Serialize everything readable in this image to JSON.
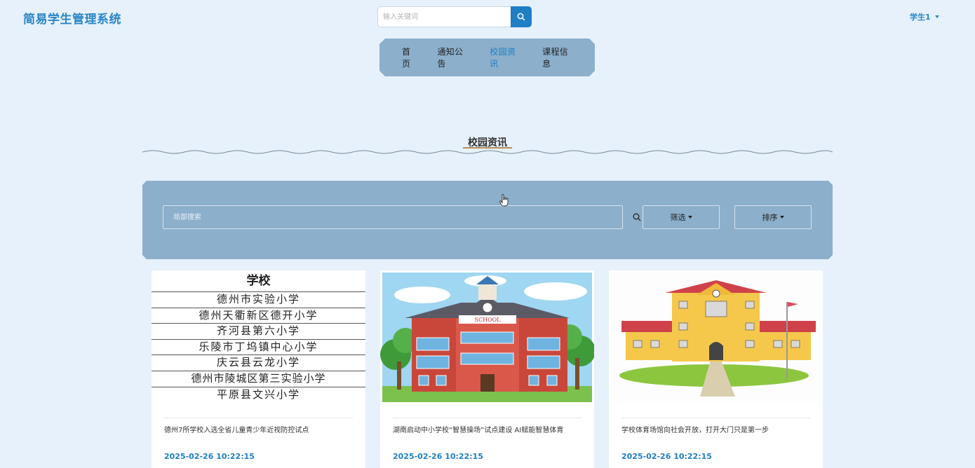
{
  "header": {
    "brand": "简易学生管理系统",
    "search_placeholder": "输入关键词",
    "user_label": "学生1"
  },
  "nav": {
    "items": [
      {
        "label": "首页",
        "active": false
      },
      {
        "label": "通知公告",
        "active": false
      },
      {
        "label": "校园资讯",
        "active": true
      },
      {
        "label": "课程信息",
        "active": false
      }
    ]
  },
  "section": {
    "title": "校园资讯"
  },
  "filter": {
    "search_placeholder": "局部搜索",
    "filter_label": "筛选",
    "sort_label": "排序"
  },
  "cards": [
    {
      "title": "德州7所学校入选全省儿童青少年近视防控试点",
      "date": "2025-02-26 10:22:15",
      "image": {
        "heading": "学校",
        "rows": [
          "德州市实验小学",
          "德州天衢新区德开小学",
          "齐河县第六小学",
          "乐陵市丁坞镇中心小学",
          "庆云县云龙小学",
          "德州市陵城区第三实验小学",
          "平原县文兴小学"
        ]
      }
    },
    {
      "title": "湖南启动中小学校“智慧操场”试点建设 AI赋能智慧体育",
      "date": "2025-02-26 10:22:15",
      "image": {
        "sign": "SCHOOL"
      }
    },
    {
      "title": "学校体育场馆向社会开放，打开大门只是第一步",
      "date": "2025-02-26 10:22:15",
      "image": {}
    }
  ],
  "colors": {
    "background": "#e6f1fb",
    "accent": "#1f7ec4",
    "panel": "#8cafcb"
  }
}
